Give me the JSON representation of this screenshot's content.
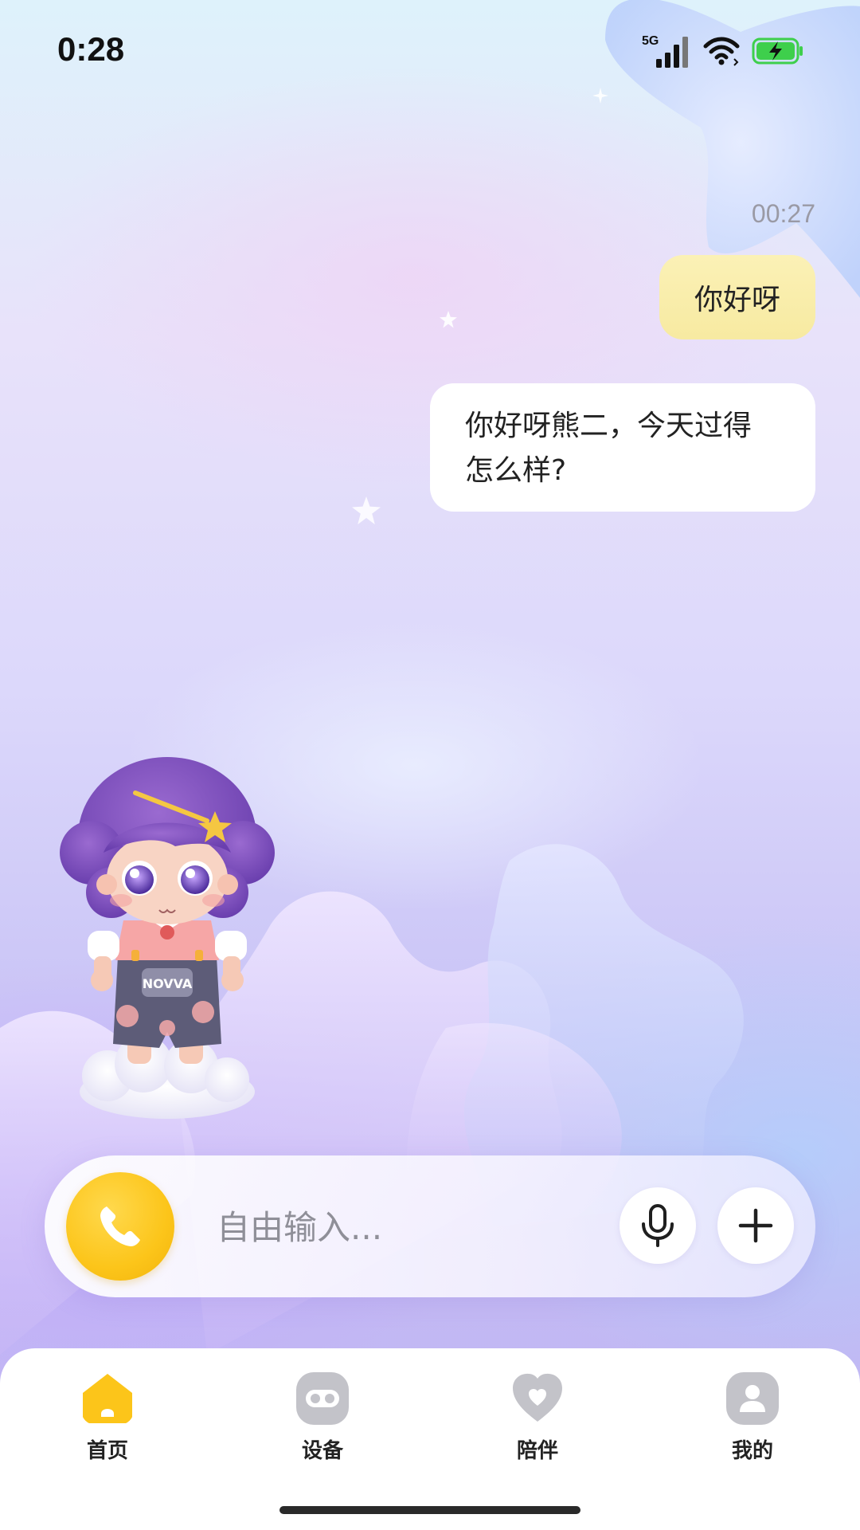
{
  "status_bar": {
    "time": "0:28",
    "network": "5G",
    "icons": [
      "cellular-signal-icon",
      "wifi-icon",
      "battery-charging-icon"
    ],
    "battery_color": "#3ecf4c"
  },
  "chat": {
    "timestamp": "00:27",
    "messages": [
      {
        "role": "user",
        "text": "你好呀"
      },
      {
        "role": "assistant",
        "text": "你好呀熊二，今天过得怎么样?"
      }
    ],
    "assistant_lines": [
      "你好呀熊二，今天过得",
      "怎么样?"
    ]
  },
  "character": {
    "badge_text": "NOVVA"
  },
  "input_bar": {
    "placeholder": "自由输入...",
    "call_icon": "phone-icon",
    "mic_icon": "microphone-icon",
    "plus_icon": "plus-icon",
    "accent": "#fcc51a"
  },
  "tab_bar": {
    "items": [
      {
        "label": "首页",
        "icon": "home-icon",
        "active": true,
        "color": "#fcc51a"
      },
      {
        "label": "设备",
        "icon": "device-icon",
        "active": false,
        "color": "#c3c3c9"
      },
      {
        "label": "陪伴",
        "icon": "heart-icon",
        "active": false,
        "color": "#c3c3c9"
      },
      {
        "label": "我的",
        "icon": "profile-icon",
        "active": false,
        "color": "#c3c3c9"
      }
    ]
  }
}
